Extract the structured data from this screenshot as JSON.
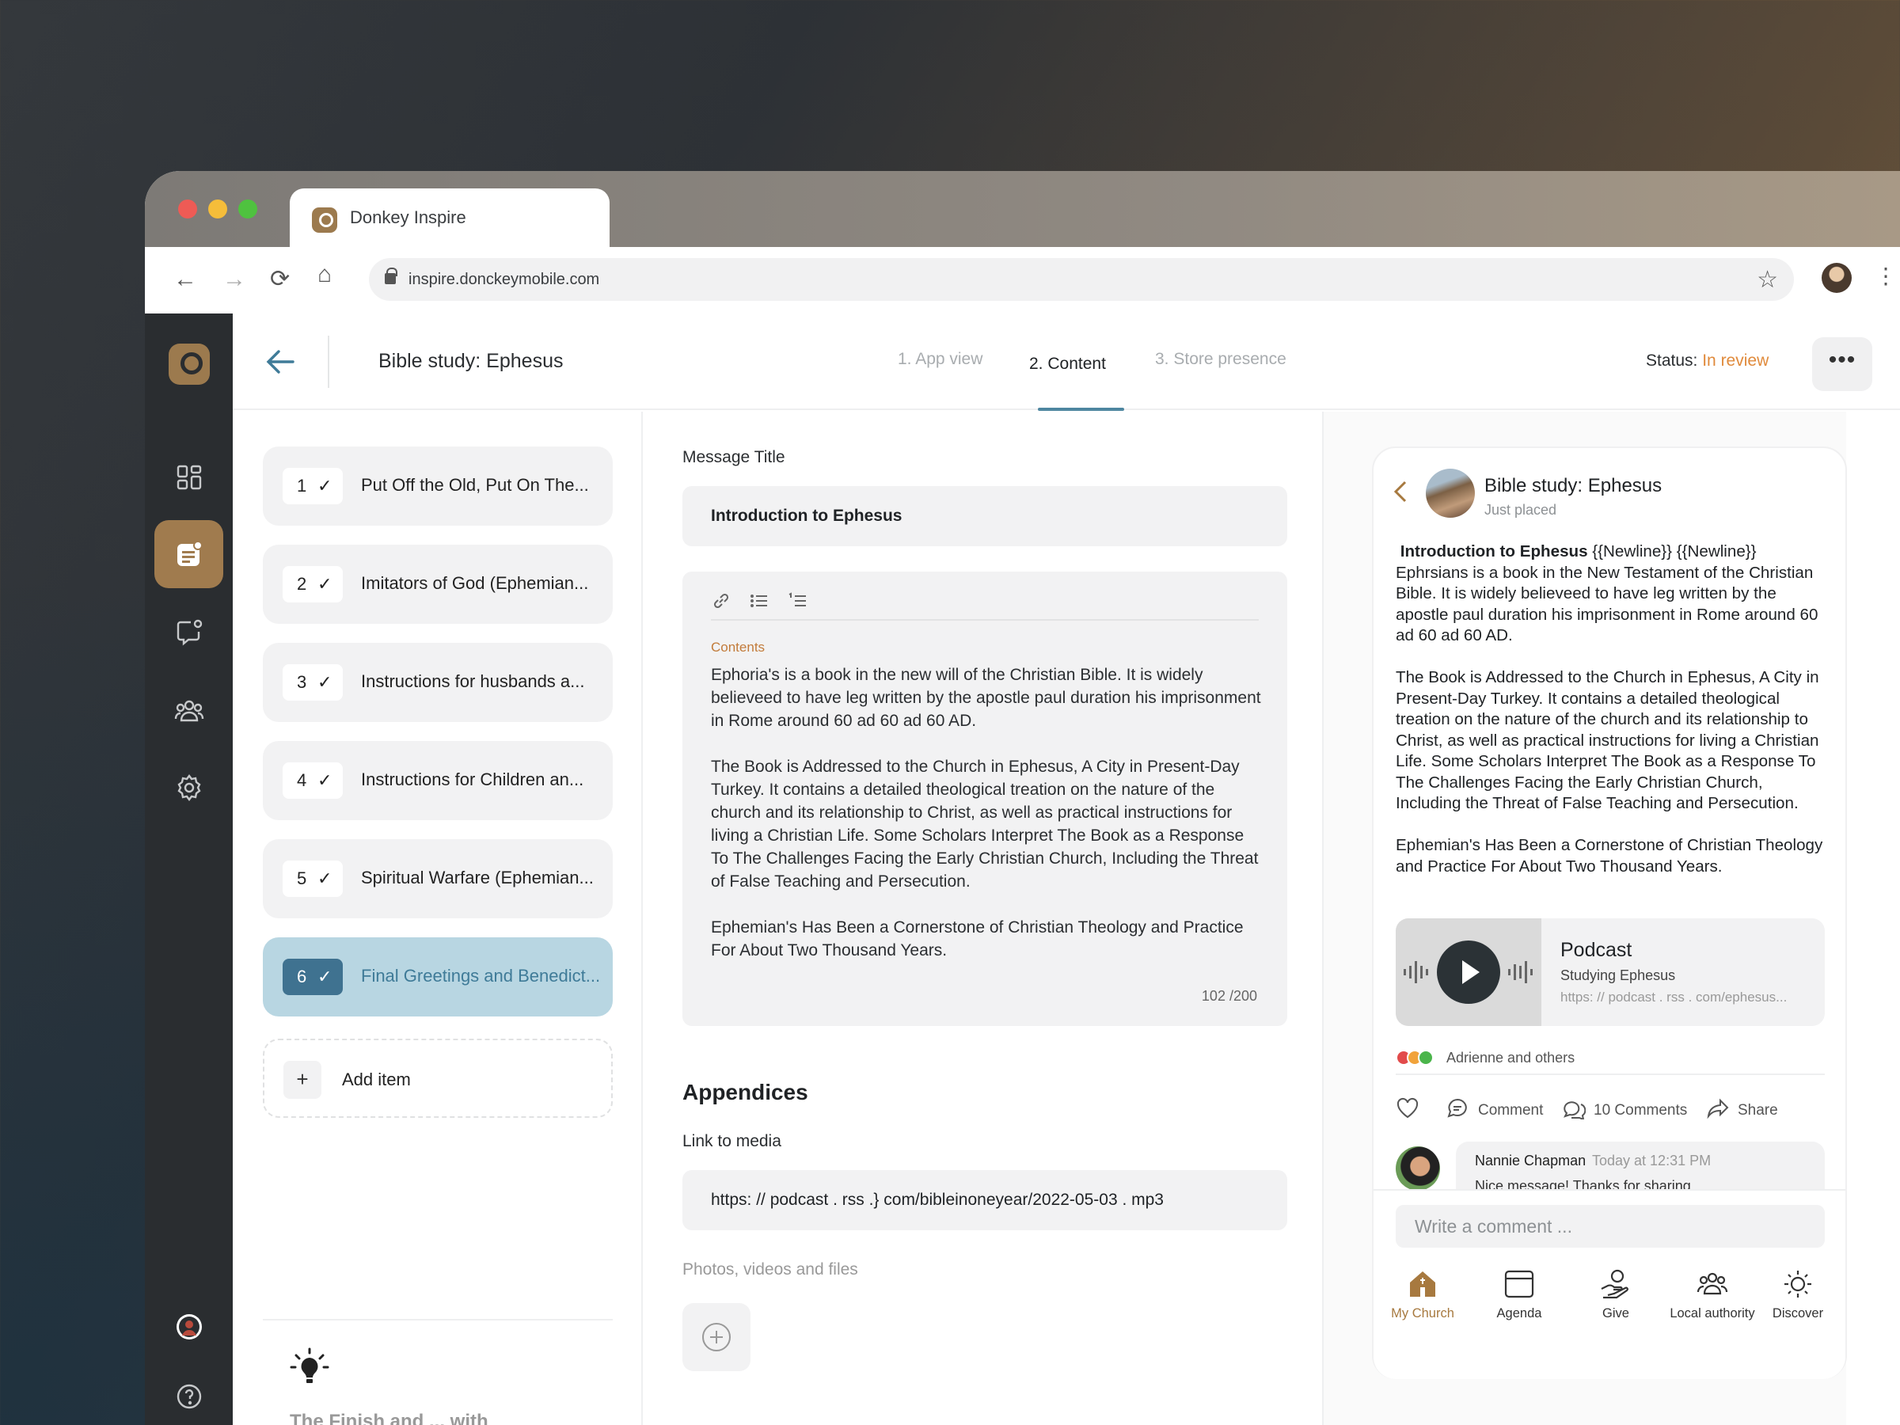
{
  "browser": {
    "tab_title": "Donkey Inspire",
    "url": "inspire.donckeymobile.com"
  },
  "header": {
    "title": "Bible study: Ephesus",
    "steps": [
      {
        "label": "1. App view",
        "active": false
      },
      {
        "label": "2. Content",
        "active": true
      },
      {
        "label": "3. Store presence",
        "active": false
      }
    ],
    "status_label": "Status:",
    "status_value": "In review",
    "more_label": "•••"
  },
  "sidebar": {
    "items": [
      {
        "name": "dashboard-icon",
        "active": false
      },
      {
        "name": "content-icon",
        "active": true
      },
      {
        "name": "messages-icon",
        "active": false
      },
      {
        "name": "community-icon",
        "active": false
      },
      {
        "name": "settings-icon",
        "active": false
      }
    ]
  },
  "chapters": {
    "items": [
      {
        "num": "1",
        "label": "Put Off the Old, Put On The..."
      },
      {
        "num": "2",
        "label": "Imitators of God (Ephemian..."
      },
      {
        "num": "3",
        "label": "Instructions for husbands a..."
      },
      {
        "num": "4",
        "label": "Instructions for Children an..."
      },
      {
        "num": "5",
        "label": "Spiritual Warfare (Ephemian..."
      },
      {
        "num": "6",
        "label": "Final Greetings and Benedict..."
      }
    ],
    "selected": 6,
    "add_label": "Add item",
    "add_symbol": "+",
    "tip_text": "The Finish and ... with"
  },
  "editor": {
    "message_title_label": "Message Title",
    "message_title_value": "Introduction to Ephesus",
    "contents_label": "Contents",
    "contents_paragraphs": [
      "Ephoria's is a book in the new will of the Christian Bible. It is widely believeed to have leg written by the apostle paul duration his imprisonment in Rome around 60 ad 60 ad 60 AD.",
      "The Book is Addressed to the Church in Ephesus, A City in Present-Day Turkey. It contains a detailed theological treation on the nature of the church and its relationship to Christ, as well as practical instructions for living a Christian Life. Some Scholars Interpret The Book as a Response To The Challenges Facing the Early Christian Church, Including the Threat of False Teaching and Persecution.",
      "Ephemian's Has Been a Cornerstone of Christian Theology and Practice For About Two Thousand Years."
    ],
    "char_count": "102 /200",
    "appendices_heading": "Appendices",
    "link_label": "Link to media",
    "link_value": "https: // podcast . rss .} com/bibleinoneyear/2022-05-03 . mp3",
    "photos_label": "Photos, videos and files"
  },
  "preview": {
    "title": "Bible study: Ephesus",
    "subtitle": "Just placed",
    "intro_bold": "Introduction to Ephesus",
    "intro_rest": " {{Newline}} {{Newline}} Ephrsians is a book in the New Testament of the Christian Bible. It is widely believeed to have leg written by the apostle paul duration his imprisonment in Rome around 60 ad 60 ad 60 AD.",
    "para2": "The Book is Addressed to the Church in Ephesus, A City in Present-Day Turkey. It contains a detailed theological treation on the nature of the church and its relationship to Christ, as well as practical instructions for living a Christian Life. Some Scholars Interpret The Book as a Response To The Challenges Facing the Early Christian Church, Including the Threat of False Teaching and Persecution.",
    "para3": "Ephemian's Has Been a Cornerstone of Christian Theology and Practice For About Two Thousand Years.",
    "podcast": {
      "heading": "Podcast",
      "subtitle": "Studying Ephesus",
      "link": "https: // podcast . rss . com/ephesus..."
    },
    "reactions_text": "Adrienne and others",
    "actions": {
      "comment": "Comment",
      "comments_count": "10 Comments",
      "share": "Share"
    },
    "comment": {
      "author": "Nannie Chapman",
      "time": "Today at 12:31 PM",
      "text": "Nice message!  Thanks for sharing"
    },
    "comment_placeholder": "Write a comment ...",
    "bottom_nav": [
      {
        "label": "My Church",
        "active": true
      },
      {
        "label": "Agenda",
        "active": false
      },
      {
        "label": "Give",
        "active": false
      },
      {
        "label": "Local authority",
        "active": false
      },
      {
        "label": "Discover",
        "active": false
      }
    ]
  },
  "colors": {
    "accent": "#a07b4e",
    "selected_blue": "#3f7290",
    "status": "#e08a3b",
    "sidebar": "#2a2d30"
  }
}
